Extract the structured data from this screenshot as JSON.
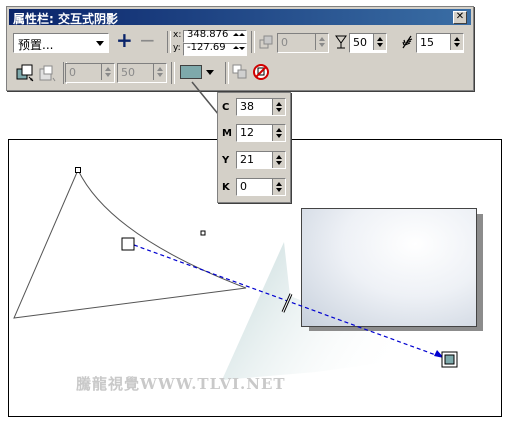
{
  "propbar": {
    "title": "属性栏: 交互式阴影",
    "close_glyph": "✕",
    "preset_value": "预置...",
    "add_glyph": "+",
    "remove_glyph": "−",
    "x_label": "x:",
    "x_value": "348.876",
    "y_label": "y:",
    "y_value": "-127.69",
    "angle_value": "0",
    "opacity_value": "50",
    "feather_value": "15",
    "row2_field1": "0",
    "row2_field2": "50",
    "shadow_color": "#7ea9ab"
  },
  "cmyk": {
    "c_label": "C",
    "c_value": "38",
    "m_label": "M",
    "m_value": "12",
    "y_label": "Y",
    "y_value": "21",
    "k_label": "K",
    "k_value": "0"
  },
  "canvas": {
    "watermark": "騰龍視覺WWW.TLVI.NET"
  }
}
